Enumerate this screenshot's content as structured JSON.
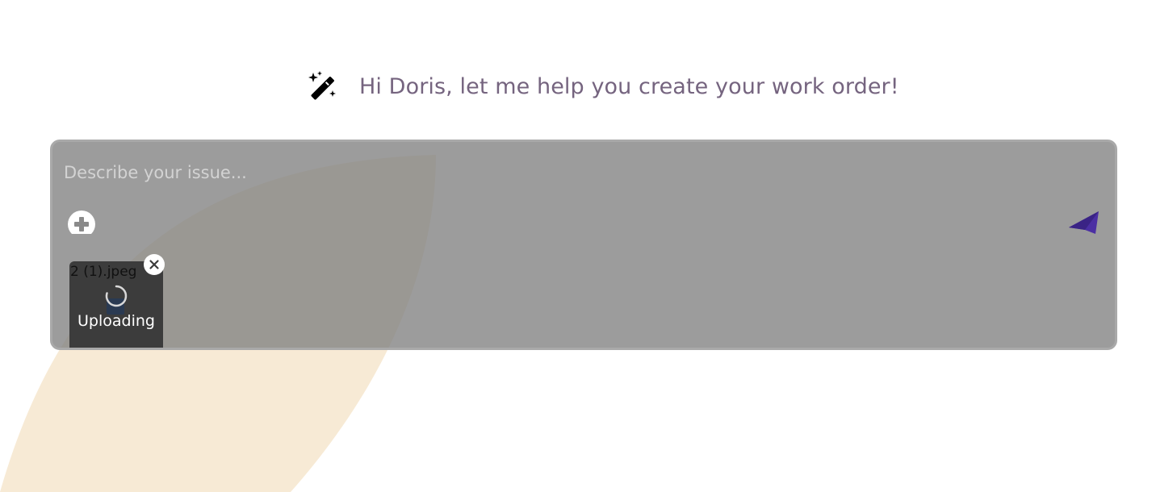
{
  "colors": {
    "greeting_text": "#75647f",
    "composer_overlay": "#808080",
    "send_accent": "#4b2fa3",
    "leaf_background": "#f7ead5"
  },
  "greeting": {
    "icon": "magic-wand-icon",
    "text": "Hi Doris, let me help you create your work order!"
  },
  "composer": {
    "placeholder": "Describe your issue...",
    "value": "",
    "add_icon": "plus-circle-icon",
    "send_icon": "paper-plane-icon",
    "attachments": [
      {
        "file_name": "2 (1).jpeg",
        "status": "Uploading",
        "remove_icon": "close-icon",
        "spinner_icon": "spinner-icon"
      }
    ]
  }
}
